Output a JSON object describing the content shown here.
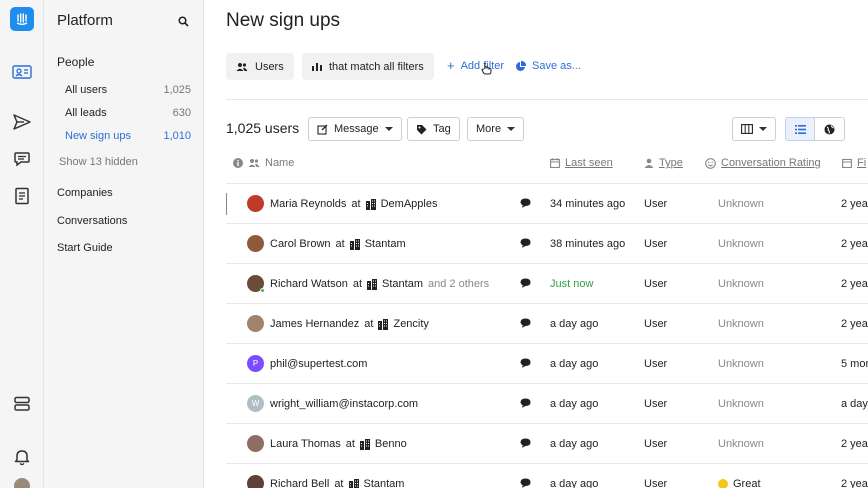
{
  "sidebar": {
    "title": "Platform",
    "people_heading": "People",
    "items": [
      {
        "label": "All users",
        "count": "1,025"
      },
      {
        "label": "All leads",
        "count": "630"
      },
      {
        "label": "New sign ups",
        "count": "1,010"
      }
    ],
    "show_hidden": "Show 13 hidden",
    "sections": [
      "Companies",
      "Conversations",
      "Start Guide"
    ]
  },
  "main": {
    "title": "New sign ups",
    "filters": {
      "users": "Users",
      "match": "that match all filters",
      "add_filter": "Add filter",
      "save_as": "Save as..."
    },
    "user_count": "1,025 users",
    "actions": {
      "message": "Message",
      "tag": "Tag",
      "more": "More"
    },
    "columns": {
      "name": "Name",
      "last_seen": "Last seen",
      "type": "Type",
      "rating": "Conversation Rating",
      "next": "Fi"
    }
  },
  "rows": [
    {
      "name": "Maria Reynolds",
      "at": "at",
      "company": "DemApples",
      "extra": "",
      "last_seen": "34 minutes ago",
      "type": "User",
      "rating": "Unknown",
      "next": "2 yea",
      "initial": "",
      "avatar_color": "#c0392b"
    },
    {
      "name": "Carol Brown",
      "at": "at",
      "company": "Stantam",
      "extra": "",
      "last_seen": "38 minutes ago",
      "type": "User",
      "rating": "Unknown",
      "next": "2 yea",
      "initial": "",
      "avatar_color": "#8e5a3c"
    },
    {
      "name": "Richard Watson",
      "at": "at",
      "company": "Stantam",
      "extra": "and 2 others",
      "last_seen": "Just now",
      "type": "User",
      "rating": "Unknown",
      "next": "2 yea",
      "initial": "",
      "avatar_color": "#6b4c3b"
    },
    {
      "name": "James Hernandez",
      "at": "at",
      "company": "Zencity",
      "extra": "",
      "last_seen": "a day ago",
      "type": "User",
      "rating": "Unknown",
      "next": "2 yea",
      "initial": "",
      "avatar_color": "#a0826d"
    },
    {
      "name": "phil@supertest.com",
      "at": "",
      "company": "",
      "extra": "",
      "last_seen": "a day ago",
      "type": "User",
      "rating": "Unknown",
      "next": "5 mor",
      "initial": "P",
      "avatar_color": "#7c4dff"
    },
    {
      "name": "wright_william@instacorp.com",
      "at": "",
      "company": "",
      "extra": "",
      "last_seen": "a day ago",
      "type": "User",
      "rating": "Unknown",
      "next": "a day",
      "initial": "W",
      "avatar_color": "#b0bec5"
    },
    {
      "name": "Laura Thomas",
      "at": "at",
      "company": "Benno",
      "extra": "",
      "last_seen": "a day ago",
      "type": "User",
      "rating": "Unknown",
      "next": "2 yea",
      "initial": "",
      "avatar_color": "#8d6e63"
    },
    {
      "name": "Richard Bell",
      "at": "at",
      "company": "Stantam",
      "extra": "",
      "last_seen": "a day ago",
      "type": "User",
      "rating": "Great",
      "next": "2 yea",
      "initial": "",
      "avatar_color": "#5d4037"
    }
  ]
}
